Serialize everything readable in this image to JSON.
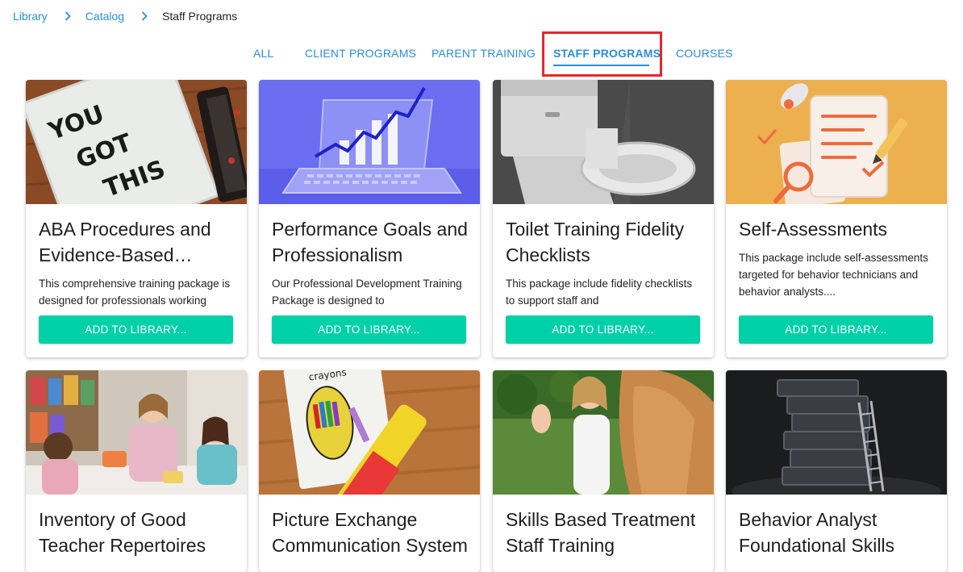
{
  "breadcrumb": {
    "items": [
      "Library",
      "Catalog"
    ],
    "current": "Staff Programs"
  },
  "tabs": [
    {
      "label": "ALL",
      "active": false
    },
    {
      "label": "CLIENT PROGRAMS",
      "active": false
    },
    {
      "label": "PARENT TRAINING",
      "active": false
    },
    {
      "label": "STAFF PROGRAMS",
      "active": true
    },
    {
      "label": "COURSES",
      "active": false
    }
  ],
  "colors": {
    "accent": "#2a8dd8",
    "button": "#00d0a8",
    "highlight": "#e8262b"
  },
  "cards": [
    {
      "title": "ABA Procedures and Evidence-Based Practices",
      "description": "This comprehensive training package is designed for professionals working",
      "button": "ADD TO LIBRARY...",
      "image": "you-got-this-lightbox"
    },
    {
      "title": "Performance Goals and Professionalism",
      "description": "Our Professional Development Training Package is designed to",
      "button": "ADD TO LIBRARY...",
      "image": "laptop-growth-chart"
    },
    {
      "title": "Toilet Training Fidelity Checklists",
      "description": "This package include fidelity checklists to support staff and",
      "button": "ADD TO LIBRARY...",
      "image": "toilet"
    },
    {
      "title": "Self-Assessments",
      "description": "This package include self-assessments targeted for behavior technicians and behavior analysts....",
      "button": "ADD TO LIBRARY...",
      "image": "documents-checklist"
    },
    {
      "title": "Inventory of Good Teacher Repertoires",
      "image": "classroom-children"
    },
    {
      "title": "Picture Exchange Communication System",
      "image": "crayons-card",
      "image_text": "crayons"
    },
    {
      "title": "Skills Based Treatment Staff Training",
      "image": "high-five"
    },
    {
      "title": "Behavior Analyst Foundational Skills",
      "image": "book-stack-ladder"
    }
  ]
}
